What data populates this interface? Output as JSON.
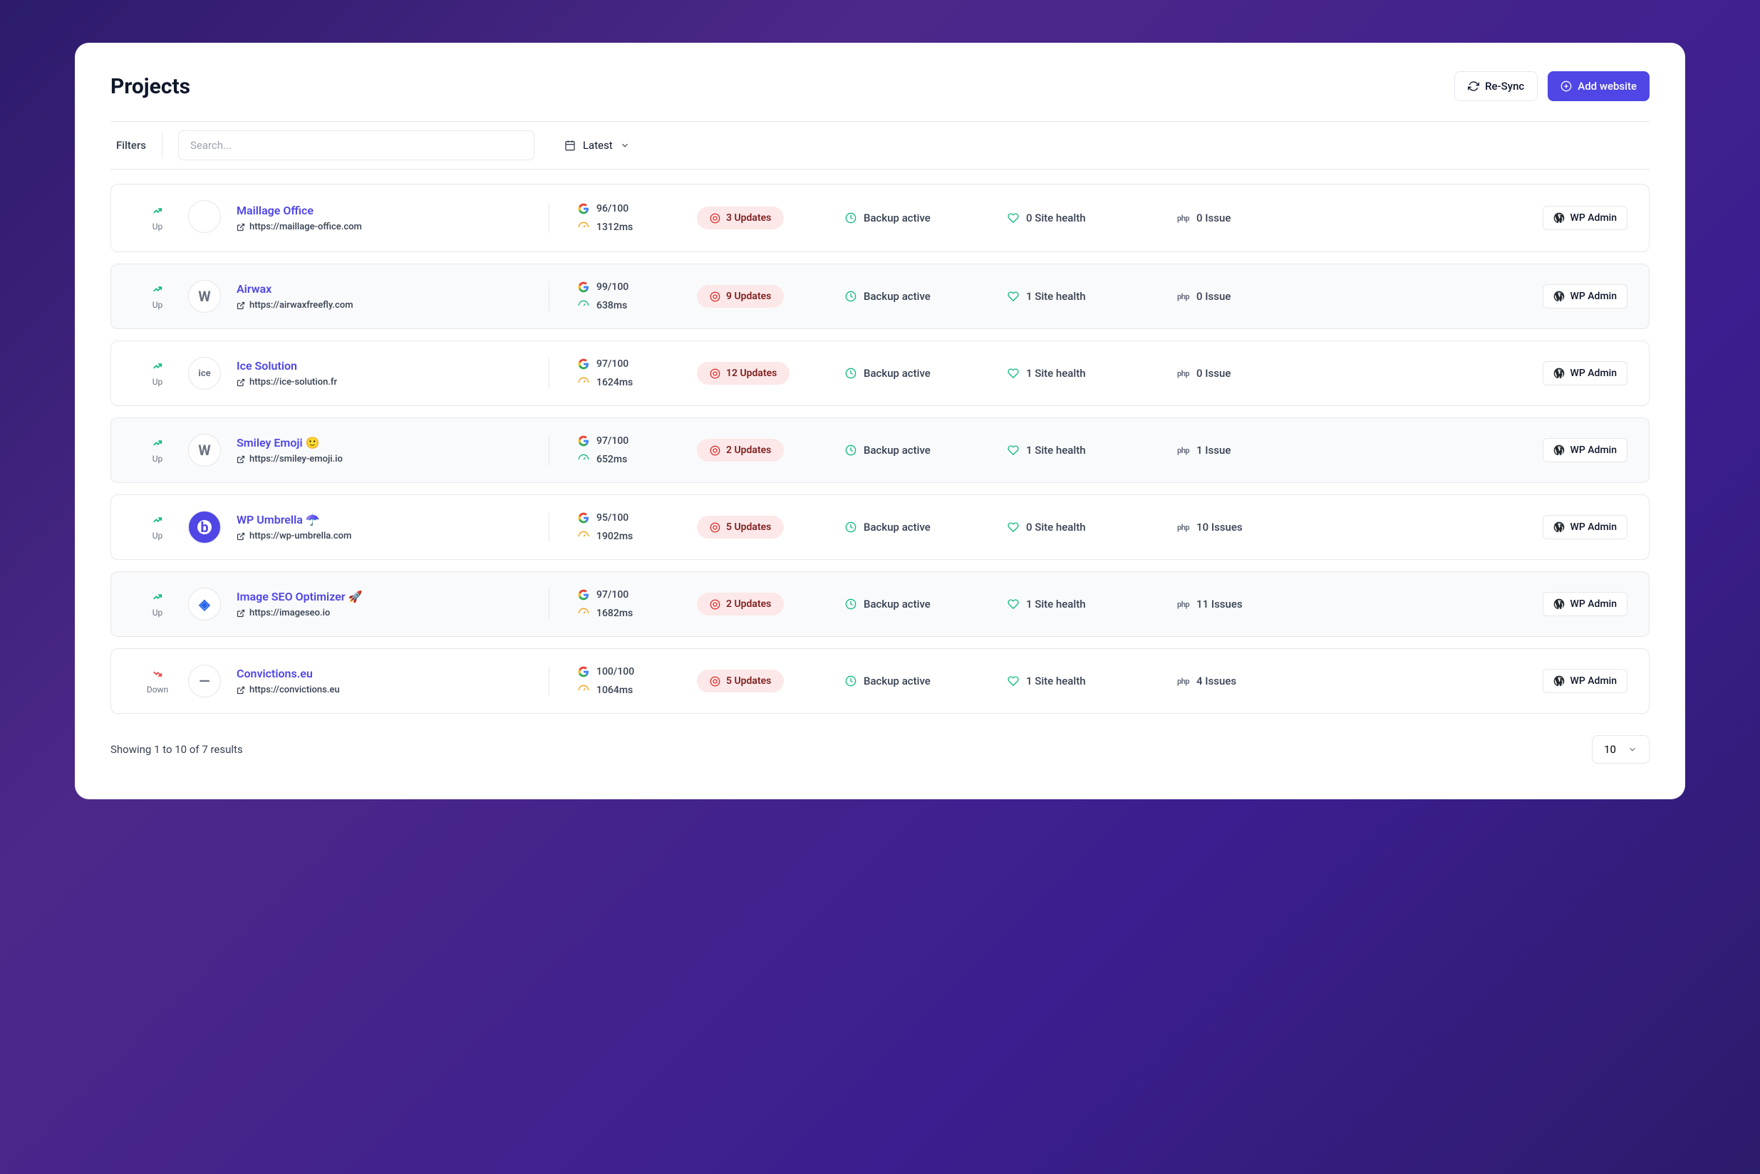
{
  "page": {
    "title": "Projects",
    "resync_label": "Re-Sync",
    "add_label": "Add website",
    "filters_label": "Filters",
    "search_placeholder": "Search...",
    "sort_label": "Latest",
    "wp_admin_label": "WP Admin",
    "backup_label": "Backup active"
  },
  "rows": [
    {
      "status": "Up",
      "up": true,
      "name": "Maillage Office",
      "url": "https://maillage-office.com",
      "score": "96/100",
      "latency": "1312ms",
      "updates": "3 Updates",
      "health": "0 Site health",
      "issues": "0 Issue",
      "avatar": ""
    },
    {
      "status": "Up",
      "up": true,
      "name": "Airwax",
      "url": "https://airwaxfreefly.com",
      "score": "99/100",
      "latency": "638ms",
      "updates": "9 Updates",
      "health": "1 Site health",
      "issues": "0 Issue",
      "avatar": "W"
    },
    {
      "status": "Up",
      "up": true,
      "name": "Ice Solution",
      "url": "https://ice-solution.fr",
      "score": "97/100",
      "latency": "1624ms",
      "updates": "12 Updates",
      "health": "1 Site health",
      "issues": "0 Issue",
      "avatar": "ice"
    },
    {
      "status": "Up",
      "up": true,
      "name": "Smiley Emoji 🙂",
      "url": "https://smiley-emoji.io",
      "score": "97/100",
      "latency": "652ms",
      "updates": "2 Updates",
      "health": "1 Site health",
      "issues": "1 Issue",
      "avatar": "W"
    },
    {
      "status": "Up",
      "up": true,
      "name": "WP Umbrella ☂️",
      "url": "https://wp-umbrella.com",
      "score": "95/100",
      "latency": "1902ms",
      "updates": "5 Updates",
      "health": "0 Site health",
      "issues": "10 Issues",
      "avatar": "b"
    },
    {
      "status": "Up",
      "up": true,
      "name": "Image SEO Optimizer 🚀",
      "url": "https://imageseo.io",
      "score": "97/100",
      "latency": "1682ms",
      "updates": "2 Updates",
      "health": "1 Site health",
      "issues": "11 Issues",
      "avatar": "◈"
    },
    {
      "status": "Down",
      "up": false,
      "name": "Convictions.eu",
      "url": "https://convictions.eu",
      "score": "100/100",
      "latency": "1064ms",
      "updates": "5 Updates",
      "health": "1 Site health",
      "issues": "4 Issues",
      "avatar": "—"
    }
  ],
  "pagination": {
    "text": "Showing 1 to 10 of 7 results",
    "page_size": "10"
  }
}
